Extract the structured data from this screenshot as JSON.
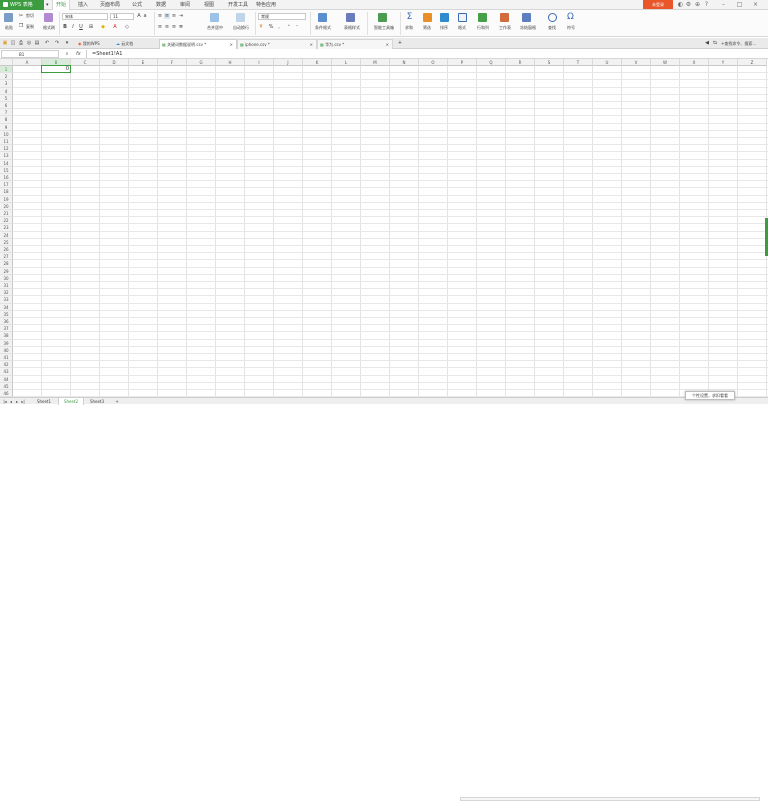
{
  "app": {
    "name": "WPS 表格",
    "login": "未登录"
  },
  "menus": [
    "开始",
    "插入",
    "页面布局",
    "公式",
    "数据",
    "审阅",
    "视图",
    "开发工具",
    "特色应用"
  ],
  "active_menu": "开始",
  "ribbon": {
    "paste": "粘贴",
    "cut": "剪切",
    "copy": "复制",
    "format_painter": "格式刷",
    "font_name": "宋体",
    "font_size": "11",
    "merge_center": "合并居中",
    "wrap_text": "自动换行",
    "number_format": "常规",
    "cond_format": "条件格式",
    "table_style": "表格样式",
    "smart_toolbox": "智能工具箱",
    "sum": "求和",
    "filter": "筛选",
    "sort": "排序",
    "format": "格式",
    "row_col": "行和列",
    "worksheet": "工作表",
    "freeze": "冻结窗格",
    "find": "查找",
    "symbol": "符号"
  },
  "doc_tabs": [
    {
      "label": "我的WPS"
    },
    {
      "label": "云文档"
    },
    {
      "label": "关键词数据说明.csv *"
    },
    {
      "label": "iphone.csv *"
    },
    {
      "label": "华为.csv *"
    }
  ],
  "search_hint": "+查找命令、搜索...",
  "namebox": "B1",
  "fx": "fx",
  "formula": "=Sheet1!A1",
  "columns": [
    "A",
    "B",
    "C",
    "D",
    "E",
    "F",
    "G",
    "H",
    "I",
    "J",
    "K",
    "L",
    "M",
    "N",
    "O",
    "P",
    "Q",
    "R",
    "S",
    "T",
    "U",
    "V",
    "W",
    "X",
    "Y",
    "Z"
  ],
  "rows": [
    "1",
    "2",
    "3",
    "4",
    "5",
    "6",
    "7",
    "8",
    "9",
    "10",
    "11",
    "12",
    "13",
    "14",
    "15",
    "16",
    "17",
    "18",
    "19",
    "20",
    "21",
    "22",
    "23",
    "24",
    "25",
    "26",
    "27",
    "28",
    "29",
    "30",
    "31",
    "32",
    "33",
    "34",
    "35",
    "36",
    "37",
    "38",
    "39",
    "40",
    "41",
    "42",
    "43",
    "44",
    "45",
    "46"
  ],
  "active_cell_value": "0",
  "sheets": [
    "Sheet1",
    "Sheet2",
    "Sheet3"
  ],
  "active_sheet": "Sheet2",
  "toast": "个性设置，求扣看看",
  "colors": {
    "accent": "#3c9c3f",
    "login": "#e8562a"
  }
}
